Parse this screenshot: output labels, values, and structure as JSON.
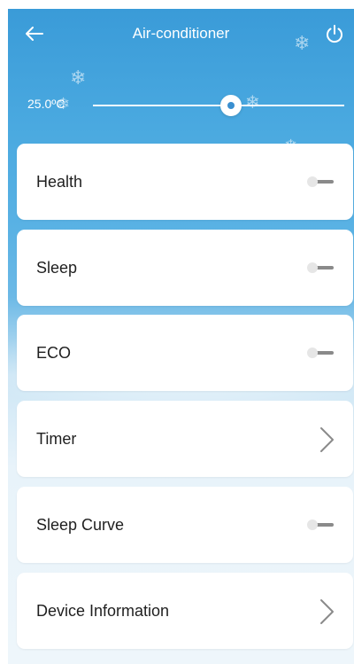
{
  "header": {
    "title": "Air-conditioner",
    "back_icon": "back-arrow-icon",
    "power_icon": "power-icon"
  },
  "temperature": {
    "value_label": "25.0ºC",
    "slider_level": 0.55
  },
  "settings": [
    {
      "label": "Health",
      "control": "toggle",
      "state": "off"
    },
    {
      "label": "Sleep",
      "control": "toggle",
      "state": "off"
    },
    {
      "label": "ECO",
      "control": "toggle",
      "state": "off"
    },
    {
      "label": "Timer",
      "control": "chevron"
    },
    {
      "label": "Sleep Curve",
      "control": "toggle",
      "state": "off"
    },
    {
      "label": "Device Information",
      "control": "chevron"
    }
  ],
  "colors": {
    "primary": "#3a9bd8",
    "card": "#ffffff",
    "text": "#1f1f1f"
  }
}
